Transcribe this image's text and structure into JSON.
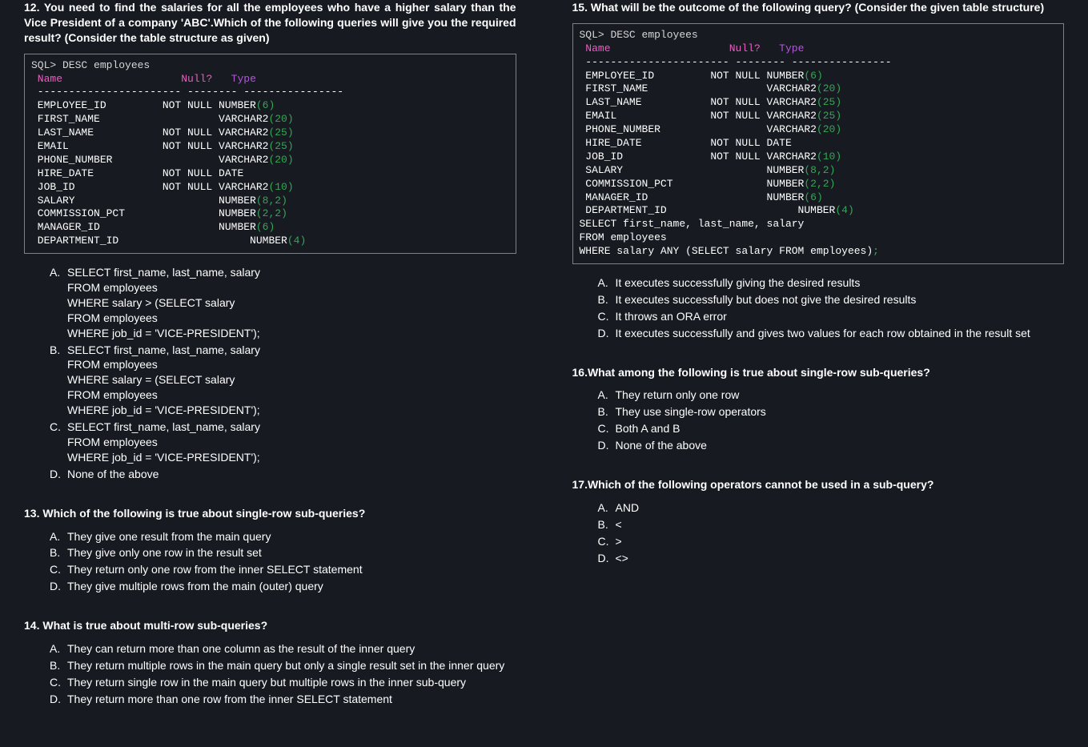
{
  "q12": {
    "text": "12. You need to find the salaries for all the employees who have a higher salary than the Vice President of a company 'ABC'.Which of the following queries will give you the required result? (Consider the table structure as given)",
    "code_prefix": "SQL> DESC employees",
    "hdr_name": " Name",
    "hdr_null": "Null?",
    "hdr_type": "Type",
    "dash": " ----------------------- -------- ----------------",
    "r1a": " EMPLOYEE_ID         NOT NULL NUMBER",
    "r1b": "(6)",
    "r2a": " FIRST_NAME                   VARCHAR2",
    "r2b": "(20)",
    "r3a": " LAST_NAME           NOT NULL VARCHAR2",
    "r3b": "(25)",
    "r4a": " EMAIL               NOT NULL VARCHAR2",
    "r4b": "(25)",
    "r5a": " PHONE_NUMBER                 VARCHAR2",
    "r5b": "(20)",
    "r6": " HIRE_DATE           NOT NULL DATE",
    "r7a": " JOB_ID              NOT NULL VARCHAR2",
    "r7b": "(10)",
    "r8a": " SALARY                       NUMBER",
    "r8b": "(8,2)",
    "r9a": " COMMISSION_PCT               NUMBER",
    "r9b": "(2,2)",
    "r10a": " MANAGER_ID                   NUMBER",
    "r10b": "(6)",
    "r11a": " DEPARTMENT_ID                     NUMBER",
    "r11b": "(4)",
    "a": "SELECT first_name, last_name, salary\nFROM employees\nWHERE salary > (SELECT salary\nFROM employees\nWHERE job_id = 'VICE-PRESIDENT');",
    "b": "SELECT first_name, last_name, salary\nFROM employees\nWHERE salary = (SELECT salary\nFROM employees\nWHERE job_id = 'VICE-PRESIDENT');",
    "c": "SELECT first_name, last_name, salary\nFROM employees\nWHERE job_id = 'VICE-PRESIDENT');",
    "d": "None of the above"
  },
  "q13": {
    "text": "13. Which of the following is true about single-row sub-queries?",
    "a": "They give one result from the main query",
    "b": "They give only one row in the result set",
    "c": "They return only one row from the inner SELECT statement",
    "d": "They give multiple rows from the main (outer) query"
  },
  "q14": {
    "text": "14. What is true about multi-row sub-queries?",
    "a": "They can return more than one column as the result of the inner query",
    "b": "They return multiple rows in the main query but only a single result set in the inner query",
    "c": "They return single row in the main query but multiple rows in the inner sub-query",
    "d": "They return more than one row from the inner SELECT statement"
  },
  "q15": {
    "text": "15. What will be the outcome of the following query? (Consider the given table structure)",
    "tail1": "SELECT first_name, last_name, salary",
    "tail2": "FROM employees",
    "tail3a": "WHERE salary ANY (SELECT salary FROM employees)",
    "tail3b": ";",
    "a": "It executes successfully giving the desired results",
    "b": "It executes successfully but does not give the desired results",
    "c": "It throws an ORA error",
    "d": "It executes successfully and gives two values for each row obtained in the result set"
  },
  "q16": {
    "text": "16.What among the following is true about single-row sub-queries?",
    "a": "They return only one row",
    "b": "They use single-row operators",
    "c": "Both A and B",
    "d": "None of the above"
  },
  "q17": {
    "text": "17.Which of the following operators cannot be used in a sub-query?",
    "a": "AND",
    "b": "<",
    "c": ">",
    "d": "<>"
  }
}
